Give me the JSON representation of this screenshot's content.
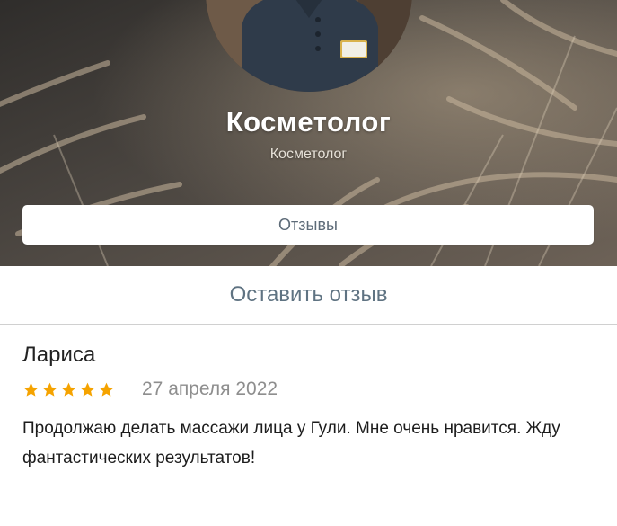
{
  "profile": {
    "title": "Косметолог",
    "subtitle": "Косметолог"
  },
  "actions": {
    "reviews_label": "Отзывы",
    "leave_review_label": "Оставить отзыв"
  },
  "reviews": [
    {
      "author": "Лариса",
      "rating": 5,
      "date": "27 апреля 2022",
      "text": "Продолжаю делать массажи лица у Гули. Мне очень нравится. Жду фантастических результатов!"
    }
  ],
  "colors": {
    "star": "#f5a300",
    "accent_text": "#5f7382",
    "button_text": "#5d6b78"
  }
}
